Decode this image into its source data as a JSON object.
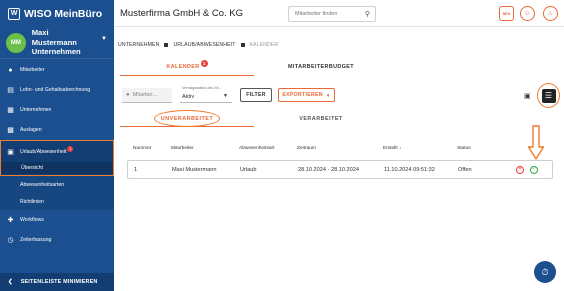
{
  "sidebar": {
    "logo_mark": "W",
    "logo_text": "WISO MeinBüro",
    "user": {
      "initials": "MM",
      "name": "Maxi Mustermann",
      "role": "Unternehmen"
    },
    "items": [
      {
        "label": "Mitarbeiter",
        "icon": "people-icon"
      },
      {
        "label": "Lohn- und Gehaltsabrechnung",
        "icon": "receipt-icon"
      },
      {
        "label": "Unternehmen",
        "icon": "building-icon"
      },
      {
        "label": "Auslagen",
        "icon": "calculator-icon"
      },
      {
        "label": "Urlaub/Abwesenheit",
        "icon": "calendar-icon",
        "badge": "1",
        "sub_active": "Übersicht"
      },
      {
        "label": "Abwesenheitsarten"
      },
      {
        "label": "Richtlinien"
      },
      {
        "label": "Workflows",
        "icon": "workflow-icon"
      },
      {
        "label": "Zeiterfassung",
        "icon": "clock-icon"
      }
    ],
    "collapse_label": "SEITENLEISTE MINIMIEREN"
  },
  "header": {
    "company": "Musterfirma GmbH & Co. KG",
    "search_placeholder": "Mitarbeiter finden",
    "btn_new": "NEU"
  },
  "breadcrumb": [
    "UNTERNEHMEN",
    "URLAUB/ABWESENHEIT",
    "KALENDER"
  ],
  "tabs": [
    {
      "label": "KALENDER",
      "badge": "1",
      "active": true
    },
    {
      "label": "MITARBEITERBUDGET",
      "active": false
    }
  ],
  "filters": {
    "mitarbeiter_placeholder": "Mitarbei...",
    "status_label": "Vertragsstatus des Mi...",
    "status_value": "Aktiv",
    "filter_button": "FILTER",
    "export_button": "EXPORTIEREN"
  },
  "subtabs": [
    {
      "label": "UNVERARBEITET",
      "active": true
    },
    {
      "label": "VERARBEITET",
      "active": false
    }
  ],
  "table": {
    "columns": [
      "Nummer",
      "Mitarbeiter",
      "Abwesenheitsart",
      "Zeitraum",
      "Erstellt ↓",
      "Status"
    ],
    "rows": [
      {
        "nummer": "1",
        "mitarbeiter": "Maxi Mustermann",
        "art": "Urlaub",
        "zeitraum": "28.10.2024 - 28.10.2024",
        "erstellt": "11.10.2024 09:51:32",
        "status": "Offen"
      }
    ]
  },
  "colors": {
    "sidebar": "#1b4f8f",
    "accent": "#e8693a",
    "highlight": "#f07c2a",
    "danger": "#e8413a",
    "success": "#2fa84f"
  }
}
